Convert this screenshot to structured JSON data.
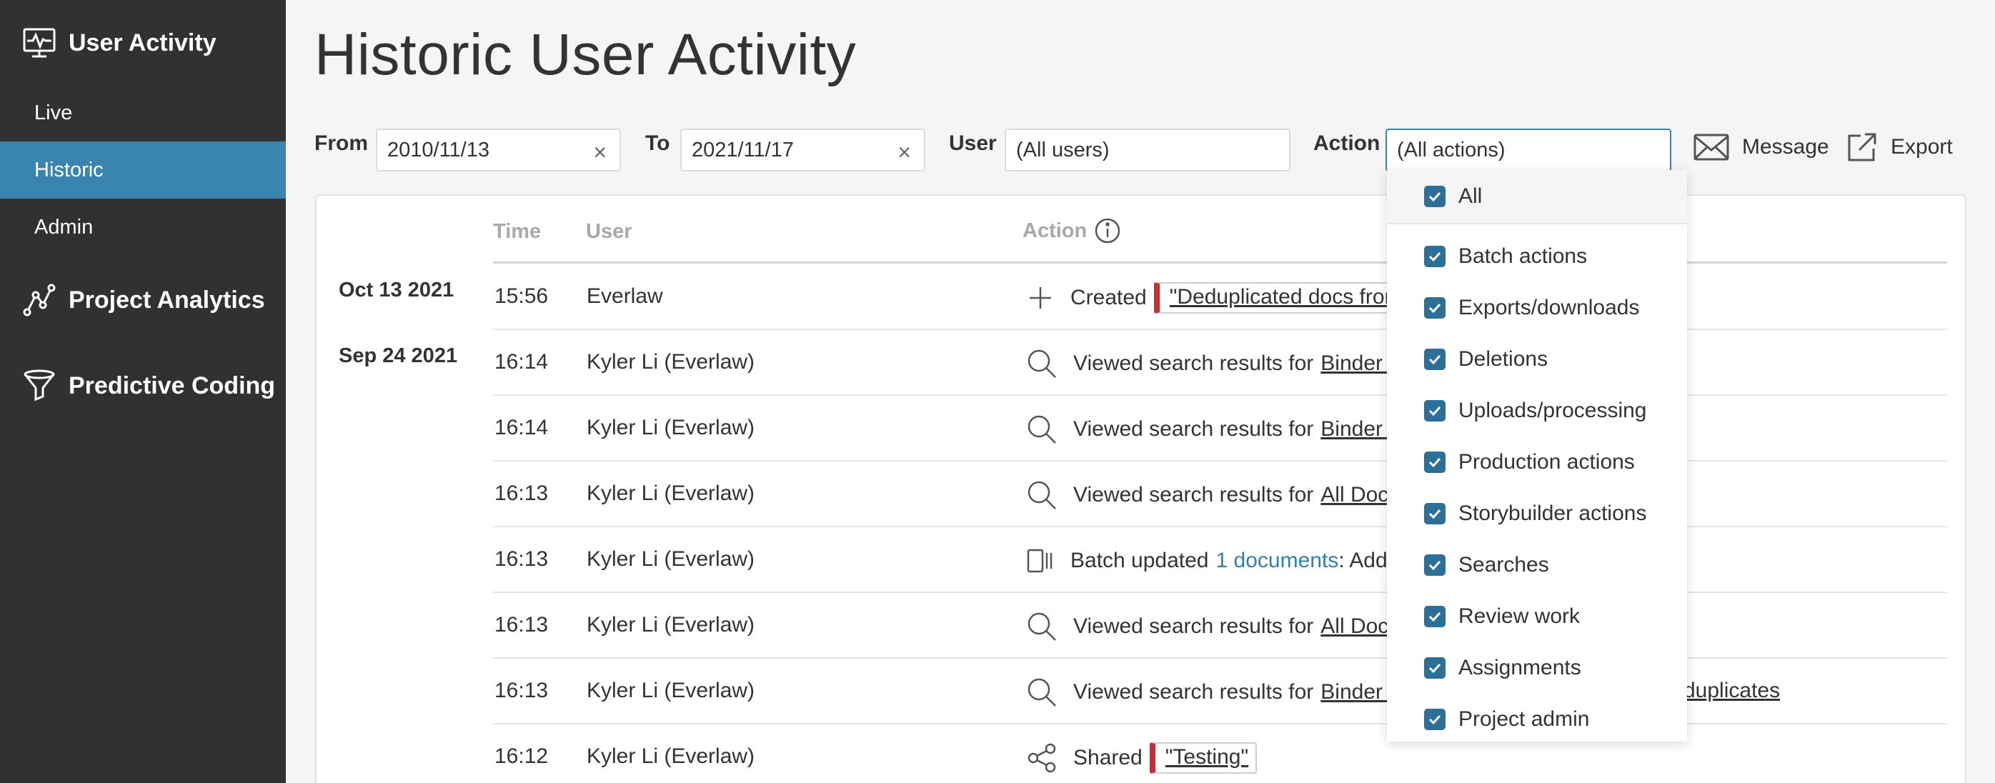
{
  "sidebar": {
    "section_user_activity": "User Activity",
    "items": [
      {
        "label": "Live"
      },
      {
        "label": "Historic"
      },
      {
        "label": "Admin"
      }
    ],
    "section_project_analytics": "Project Analytics",
    "section_predictive_coding": "Predictive Coding"
  },
  "page": {
    "title": "Historic User Activity"
  },
  "filters": {
    "from_label": "From",
    "from_value": "2010/11/13",
    "to_label": "To",
    "to_value": "2021/11/17",
    "user_label": "User",
    "user_value": "(All users)",
    "action_label": "Action",
    "action_value": "(All actions)",
    "clear_glyph": "×"
  },
  "toolbar": {
    "message_label": "Message",
    "export_label": "Export"
  },
  "table": {
    "headers": {
      "time": "Time",
      "user": "User",
      "action": "Action"
    },
    "date_groups": [
      "Oct 13 2021",
      "Sep 24 2021"
    ],
    "rows": [
      {
        "time": "15:56",
        "user": "Everlaw",
        "icon": "plus-icon",
        "action_text": "Created",
        "target": "\"Deduplicated docs from"
      },
      {
        "time": "16:14",
        "user": "Kyler Li (Everlaw)",
        "icon": "search-icon",
        "action_text": "Viewed search results for",
        "target": "Binder T"
      },
      {
        "time": "16:14",
        "user": "Kyler Li (Everlaw)",
        "icon": "search-icon",
        "action_text": "Viewed search results for",
        "target": "Binder T"
      },
      {
        "time": "16:13",
        "user": "Kyler Li (Everlaw)",
        "icon": "search-icon",
        "action_text": "Viewed search results for",
        "target": "All Docu"
      },
      {
        "time": "16:13",
        "user": "Kyler Li (Everlaw)",
        "icon": "batch-icon",
        "action_text": "Batch updated",
        "link": "1 documents",
        "suffix": ": Add"
      },
      {
        "time": "16:13",
        "user": "Kyler Li (Everlaw)",
        "icon": "search-icon",
        "action_text": "Viewed search results for",
        "target": "All Docu"
      },
      {
        "time": "16:13",
        "user": "Kyler Li (Everlaw)",
        "icon": "search-icon",
        "action_text": "Viewed search results for",
        "target": "Binder b",
        "target2": "duplicates"
      },
      {
        "time": "16:12",
        "user": "Kyler Li (Everlaw)",
        "icon": "share-icon",
        "action_text": "Shared",
        "target": "\"Testing\""
      }
    ]
  },
  "action_dropdown": {
    "items": [
      "All",
      "Batch actions",
      "Exports/downloads",
      "Deletions",
      "Uploads/processing",
      "Production actions",
      "Storybuilder actions",
      "Searches",
      "Review work",
      "Assignments",
      "Project admin"
    ]
  },
  "colors": {
    "sidebar_bg": "#2f3133",
    "active_item": "#3a84b0",
    "checkbox": "#2d6f96",
    "tag_accent": "#c62f35",
    "link": "#2f7fb0"
  }
}
